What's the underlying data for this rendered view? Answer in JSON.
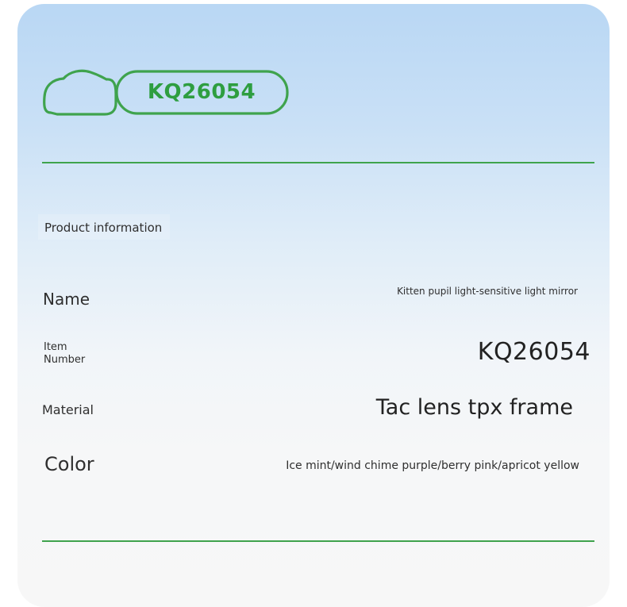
{
  "header": {
    "sku_badge": "KQ26054"
  },
  "section": {
    "title": "Product information"
  },
  "details": {
    "name_label": "Name",
    "name_value": "Kitten pupil light-sensitive light mirror",
    "item_label_line1": "Item",
    "item_label_line2": "Number",
    "item_value": "KQ26054",
    "material_label": "Material",
    "material_value": "Tac lens tpx frame",
    "color_label": "Color",
    "color_value": "Ice mint/wind chime purple/berry pink/apricot yellow"
  },
  "colors": {
    "accent_green": "#3fa34d",
    "background_top": "#b9d7f4",
    "background_bottom": "#f7f7f7"
  },
  "icons": {
    "logo": "cloud-icon"
  }
}
